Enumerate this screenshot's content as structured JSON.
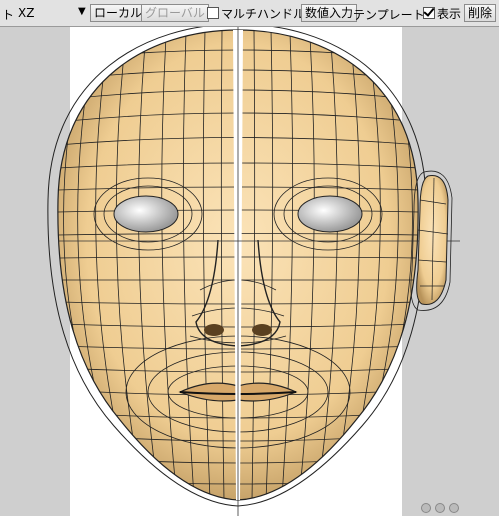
{
  "toolbar": {
    "prev_label": "ト",
    "plane_select": "XZ",
    "local_label": "ローカル",
    "global_label": "グローバル",
    "multi_handle_label": "マルチハンドル",
    "numeric_input_label": "数値入力",
    "template_label": "テンプレート",
    "show_label": "表示",
    "delete_label": "削除",
    "multi_handle_checked": false,
    "show_checked": true
  },
  "viewport": {
    "background_color": "#cfcfcf",
    "canvas_color": "#ffffff",
    "skin_color": "#f2d39d",
    "wire_color": "#1a1a1a",
    "object": "head-mesh-front-view"
  }
}
